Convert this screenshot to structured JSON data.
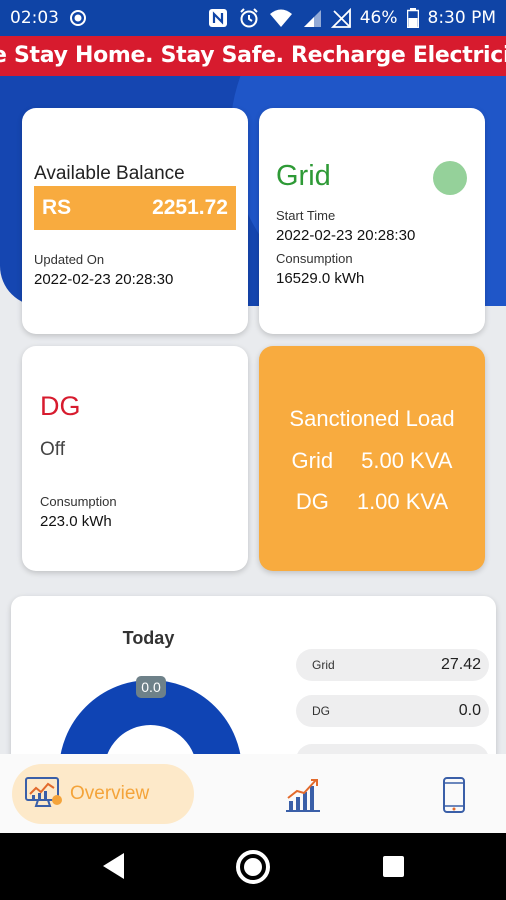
{
  "status_bar": {
    "notification_text": "02:03",
    "battery": "46%",
    "time": "8:30 PM",
    "icons": [
      "nfc-icon",
      "alarm-icon",
      "wifi-icon",
      "signal-icon",
      "no-signal-icon",
      "battery-icon"
    ]
  },
  "marquee": {
    "text": "e Stay Home. Stay Safe. Recharge Electricity Onlin"
  },
  "balance_card": {
    "title": "Available Balance",
    "currency": "RS",
    "amount": "2251.72",
    "updated_label": "Updated On",
    "updated_value": "2022-02-23 20:28:30"
  },
  "grid_card": {
    "title": "Grid",
    "start_label": "Start Time",
    "start_value": "2022-02-23 20:28:30",
    "consumption_label": "Consumption",
    "consumption_value": "16529.0 kWh",
    "status_color": "#95d19a"
  },
  "dg_card": {
    "title": "DG",
    "status": "Off",
    "consumption_label": "Consumption",
    "consumption_value": "223.0 kWh"
  },
  "load_card": {
    "title": "Sanctioned Load",
    "rows": [
      {
        "label": "Grid",
        "value": "5.00 KVA"
      },
      {
        "label": "DG",
        "value": "1.00 KVA"
      }
    ]
  },
  "today_card": {
    "title": "Today",
    "donut_value": "0.0",
    "items": [
      {
        "label": "Grid",
        "value": "27.42"
      },
      {
        "label": "DG",
        "value": "0.0"
      },
      {
        "label": "",
        "value": ""
      }
    ]
  },
  "bottom_nav": {
    "active_label": "Overview",
    "items": [
      "overview-icon",
      "analytics-icon",
      "device-icon"
    ]
  },
  "colors": {
    "primary_blue": "#1546b1",
    "accent_orange": "#f8ab3f",
    "alert_red": "#d71b2e",
    "grid_green": "#2e9a36"
  }
}
